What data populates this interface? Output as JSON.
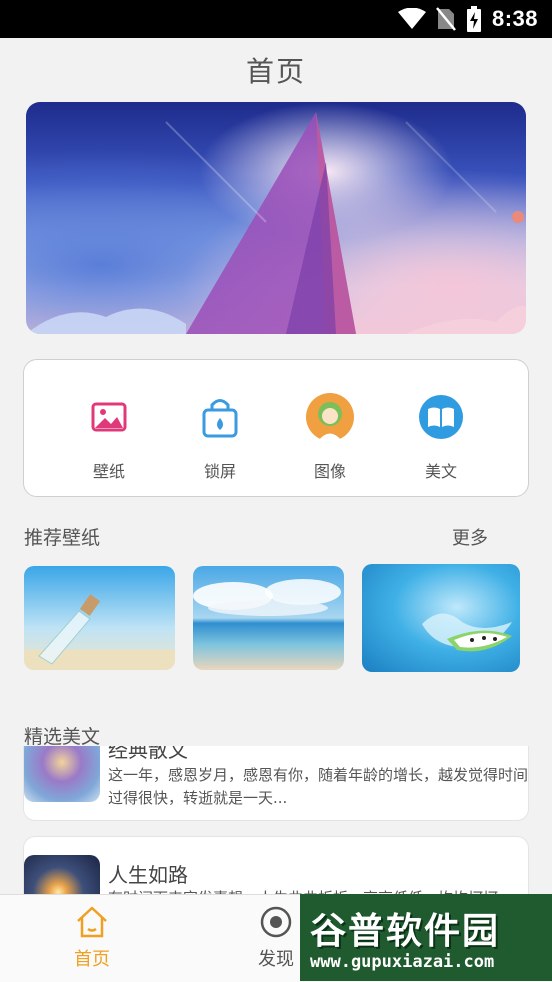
{
  "status_bar": {
    "time": "8:38",
    "icons": [
      "wifi-icon",
      "no-sim-icon",
      "battery-charging-icon"
    ]
  },
  "header": {
    "title": "首页"
  },
  "banner": {
    "image": "sailboat-sky-banner"
  },
  "quick_actions": [
    {
      "label": "壁纸",
      "icon": "wallpaper-icon",
      "color": "#e0397a"
    },
    {
      "label": "锁屏",
      "icon": "lock-screen-icon",
      "color": "#3a9be0"
    },
    {
      "label": "图像",
      "icon": "avatar-image-icon",
      "color": "#f0a040"
    },
    {
      "label": "美文",
      "icon": "book-icon",
      "color": "#2f9be0"
    }
  ],
  "recommended": {
    "title": "推荐壁纸",
    "more": "更多",
    "thumbnails": [
      "bottle-on-beach",
      "sea-and-clouds",
      "water-splash-melon"
    ]
  },
  "featured": {
    "title": "精选美文",
    "articles": [
      {
        "title": "经典散文",
        "excerpt": "这一年，感恩岁月，感恩有你，随着年龄的增长，越发觉得时间过得很快，转逝就是一天..."
      },
      {
        "title": "人生如路",
        "excerpt": "有时间下来容发喜想，人生曲曲折折，高高低低，坎坎坷坷"
      }
    ]
  },
  "bottom_nav": {
    "items": [
      {
        "label": "首页",
        "icon": "home-icon",
        "active": true
      },
      {
        "label": "发现",
        "icon": "discover-icon",
        "active": false
      }
    ],
    "active_color": "#f0a020"
  },
  "watermark": {
    "title": "谷普软件园",
    "url": "www.gupuxiazai.com"
  }
}
